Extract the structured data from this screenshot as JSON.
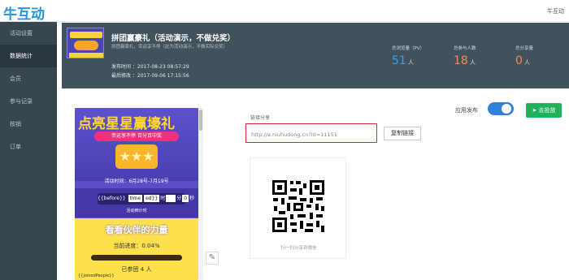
{
  "header": {
    "logo": "牛互动",
    "user_link": "牛互动"
  },
  "sidebar": {
    "items": [
      {
        "label": "活动设置"
      },
      {
        "label": "数据统计"
      },
      {
        "label": "会员"
      },
      {
        "label": "参与记录"
      },
      {
        "label": "核销"
      },
      {
        "label": "订单"
      }
    ]
  },
  "banner": {
    "title": "拼团赢豪礼（活动演示，不做兑奖）",
    "description": "拼团赢豪礼，幸运享不停（此为活动演示，不做实际兑奖）",
    "publish_time": "发布时间 ：2017-08-23 08:57:29",
    "modified_time": "最后修改 ：2017-09-06 17:15:56",
    "stats": [
      {
        "label": "总浏览量（PV）",
        "value": "51",
        "unit": "人"
      },
      {
        "label": "总参与人数",
        "value": "18",
        "unit": "人"
      },
      {
        "label": "总分享量",
        "value": "0",
        "unit": "人"
      }
    ]
  },
  "preview": {
    "title": "点亮星星赢壕礼",
    "banner_text": "幸运享不停  百分百中奖",
    "stars": "★★★",
    "date": "活动时间：6月28号-7月19号",
    "timer_text": "{{before}}",
    "timer_segments": [
      "time",
      "ed}}",
      "时",
      "分",
      "0",
      "秒"
    ],
    "timer_caption": "活动倒计时",
    "section_title": "看看伙伴的力量",
    "progress_text": "当前进度：0.04%",
    "progress_value": 0.04,
    "joined": "已参团   4    人",
    "extra": "{{joinedPeople}}"
  },
  "share": {
    "label": "链接分享",
    "url": "http://a.niuhudong.cn?id=11151",
    "copy_label": "复制链接",
    "qr_caption": "扫一扫分享到微信"
  },
  "publish": {
    "label": "应用发布",
    "toggle_on": true,
    "launch_label": "去投放",
    "launch_icon": "paper-plane-icon"
  },
  "colors": {
    "brand": "#2795d8",
    "sidebar": "#37464f",
    "banner": "#41525d",
    "pv": "#37a2e6",
    "accent": "#f08a55",
    "toggle": "#2f82d8",
    "launch": "#1eb15a",
    "highlight": "#d9262a"
  }
}
